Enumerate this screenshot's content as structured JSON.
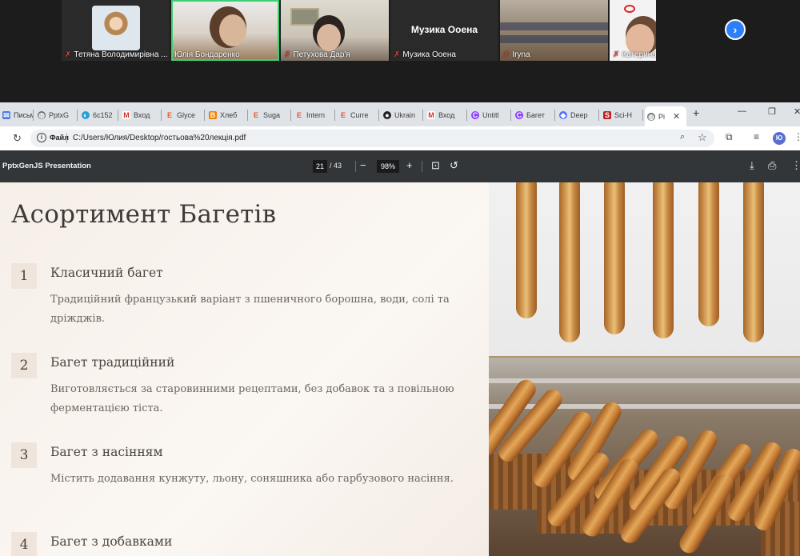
{
  "conference": {
    "participants": [
      {
        "name": "Тетяна Володимирівна ..."
      },
      {
        "name": "Юлія Бондаренко"
      },
      {
        "name": "Петухова Дар'я"
      },
      {
        "name": "Музика Ооена",
        "display_text": "Музика Ооена"
      },
      {
        "name": "Iryna"
      },
      {
        "name": "Катерина"
      }
    ],
    "next_icon": "chevron-right-icon"
  },
  "tabs": [
    {
      "label": "Письм",
      "icon": "mail-icon"
    },
    {
      "label": "PptxG",
      "icon": "globe-icon"
    },
    {
      "label": "6c152",
      "icon": "copilot-icon"
    },
    {
      "label": "Вход",
      "icon": "gmail-icon"
    },
    {
      "label": "Glyce",
      "icon": "e-icon"
    },
    {
      "label": "Хлеб",
      "icon": "blogger-icon"
    },
    {
      "label": "Suga",
      "icon": "e-icon"
    },
    {
      "label": "Intern",
      "icon": "e-icon"
    },
    {
      "label": "Curre",
      "icon": "e-icon"
    },
    {
      "label": "Ukrain",
      "icon": "github-icon"
    },
    {
      "label": "Вход",
      "icon": "gmail-icon"
    },
    {
      "label": "Untitl",
      "icon": "canva-icon"
    },
    {
      "label": "Багет",
      "icon": "canva-icon"
    },
    {
      "label": "Deep",
      "icon": "deepseek-icon"
    },
    {
      "label": "Sci-H",
      "icon": "scihub-icon"
    },
    {
      "label": "Pi",
      "icon": "globe-icon"
    }
  ],
  "address": {
    "scheme": "Файл",
    "url": "C:/Users/Юлия/Desktop/гостьова%20лекція.pdf",
    "profile_initials": "Ю"
  },
  "pdf": {
    "title": "PptxGenJS Presentation",
    "page": "21",
    "total": "/ 43",
    "zoom": "98%"
  },
  "slide": {
    "title": "Асортимент Багетів",
    "items": [
      {
        "num": "1",
        "heading": "Класичний багет",
        "desc": "Традиційний французький варіант з пшеничного борошна, води, солі та дріжджів."
      },
      {
        "num": "2",
        "heading": "Багет традиційний",
        "desc": "Виготовляється за старовинними рецептами, без добавок та з повільною ферментацією тіста."
      },
      {
        "num": "3",
        "heading": "Багет з насінням",
        "desc": "Містить додавання кунжуту, льону, соняшника або гарбузового насіння."
      },
      {
        "num": "4",
        "heading": "Багет з добавками",
        "desc": ""
      }
    ]
  },
  "colors": {
    "active_speaker": "#3cd070",
    "muted_mic": "#e0453a",
    "pdf_toolbar": "#323639",
    "slide_bg": "#f6efe8",
    "number_box": "#efe5dd"
  }
}
